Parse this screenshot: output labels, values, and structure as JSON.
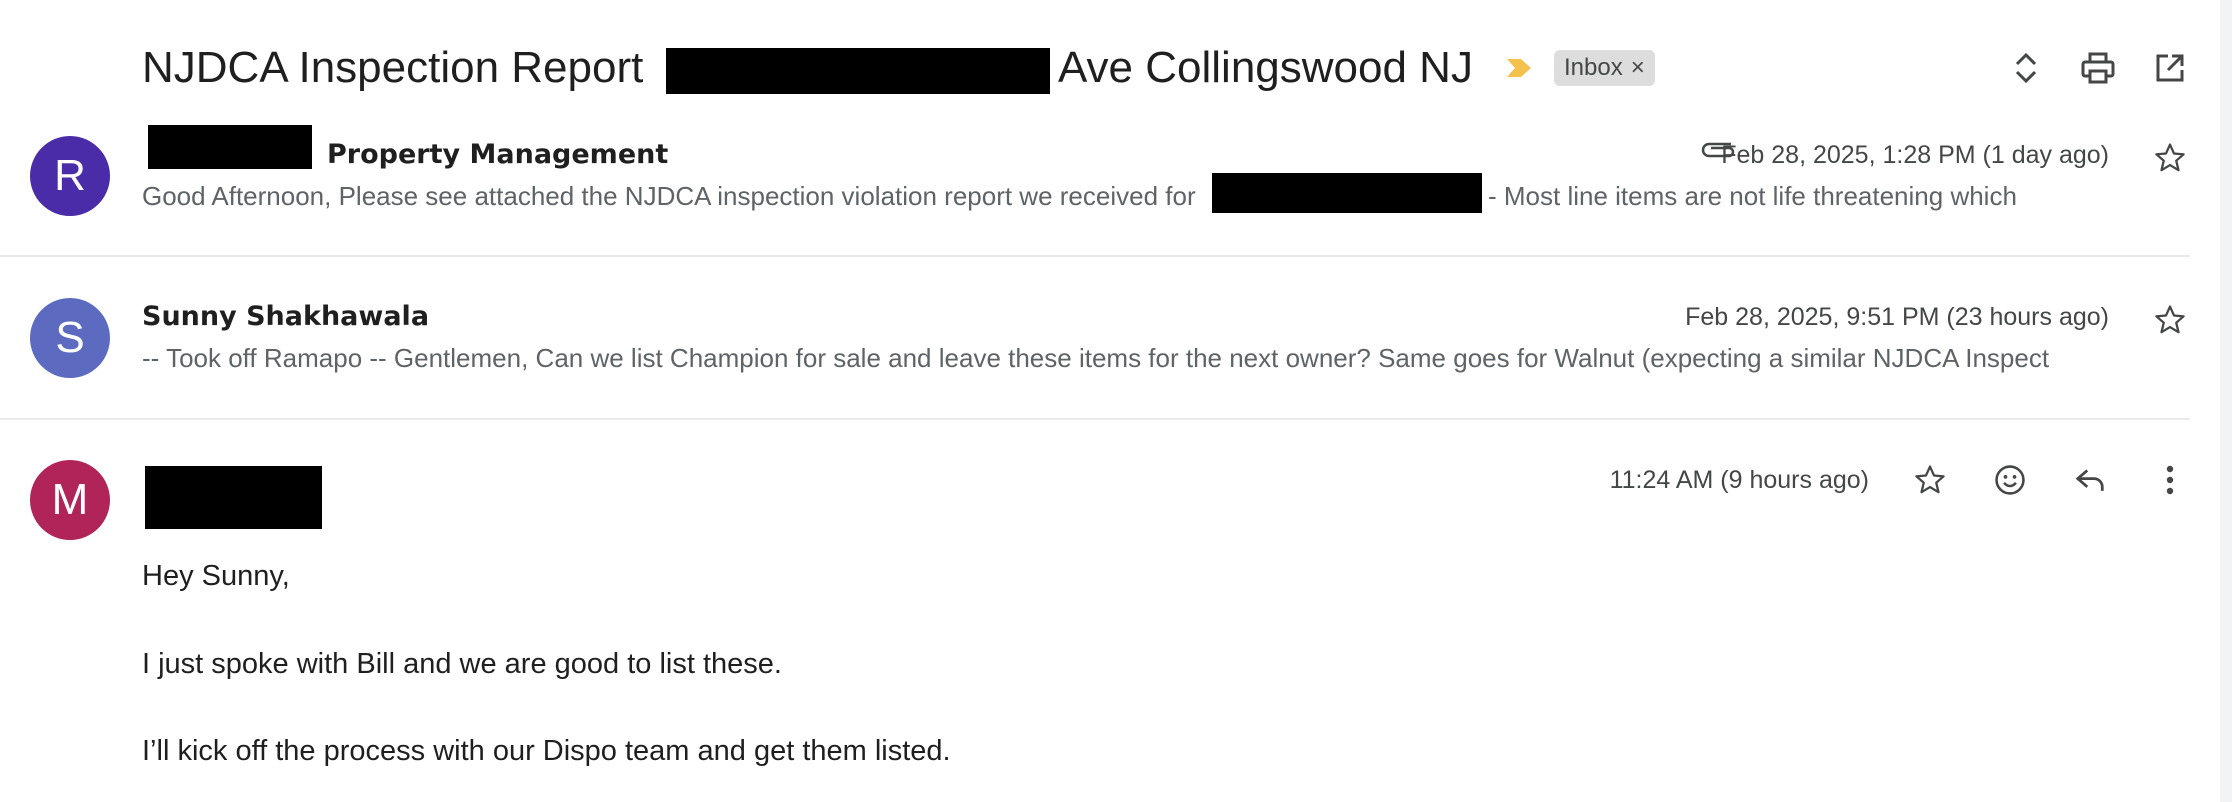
{
  "thread": {
    "subject_prefix": "NJDCA Inspection Report",
    "subject_suffix": "Ave Collingswood NJ",
    "label_chip": "Inbox",
    "label_chip_close": "×"
  },
  "toolbar": {
    "expand_icon": "unfold-icon",
    "print_icon": "print-icon",
    "open_new_window_icon": "open-in-new-icon"
  },
  "messages": [
    {
      "avatar_letter": "R",
      "avatar_color": "#4a2ba8",
      "sender": "Property Management",
      "date": "Feb 28, 2025, 1:28 PM (1 day ago)",
      "has_attachment": true,
      "snippet_start": "Good Afternoon, Please see attached the NJDCA inspection violation report we received for",
      "snippet_end": "- Most line items are not life threatening which"
    },
    {
      "avatar_letter": "S",
      "avatar_color": "#5c6bc0",
      "sender": "Sunny Shakhawala",
      "date": "Feb 28, 2025, 9:51 PM (23 hours ago)",
      "snippet": "-- Took off Ramapo -- Gentlemen, Can we list Champion for sale and leave these items for the next owner? Same goes for Walnut (expecting a similar NJDCA Inspect"
    },
    {
      "avatar_letter": "M",
      "avatar_color": "#b0245a",
      "date": "11:24 AM (9 hours ago)",
      "body": [
        "Hey Sunny,",
        "I just spoke with Bill and we are good to list these.",
        "I’ll kick off the process with our Dispo team and get them listed."
      ]
    }
  ]
}
